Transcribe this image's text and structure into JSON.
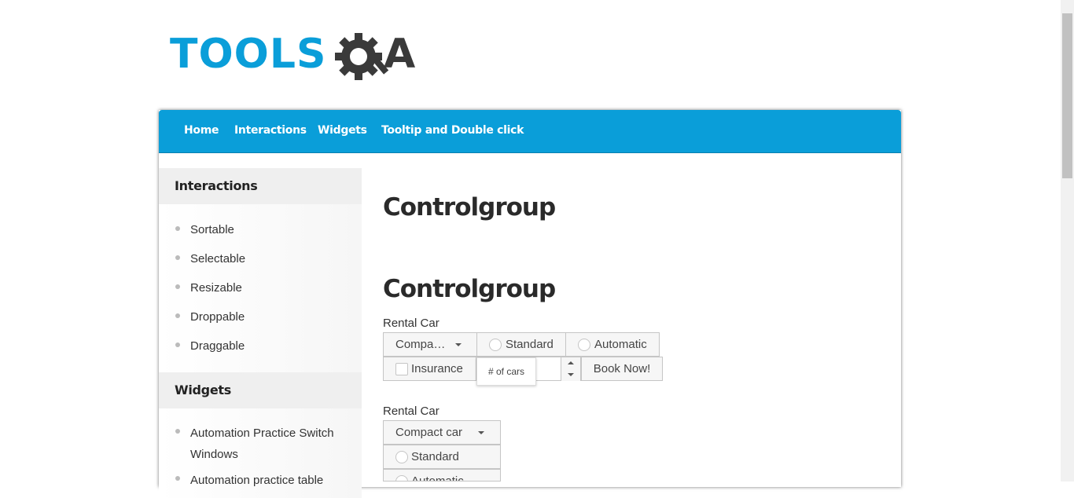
{
  "logo": {
    "text_left": "TOOLS",
    "text_right": "A",
    "brand_color": "#0a9ed9",
    "dark_color": "#3a3a3a"
  },
  "nav": {
    "items": [
      "Home",
      "Interactions",
      "Widgets",
      "Tooltip and Double click"
    ],
    "color": "#0a9ed9"
  },
  "sidebar": {
    "interactions_heading": "Interactions",
    "interactions": [
      "Sortable",
      "Selectable",
      "Resizable",
      "Droppable",
      "Draggable"
    ],
    "widgets_heading": "Widgets",
    "widgets": [
      "Automation Practice Switch Windows",
      "Automation practice table"
    ]
  },
  "main": {
    "title": "Controlgroup",
    "section_title": "Controlgroup",
    "group1": {
      "label": "Rental Car",
      "car_select": "Compa…",
      "standard": "Standard",
      "automatic": "Automatic",
      "insurance": "Insurance",
      "cars_placeholder": "# of cars",
      "book": "Book Now!"
    },
    "group2": {
      "label": "Rental Car",
      "car_select": "Compact car",
      "standard": "Standard",
      "automatic": "Automatic"
    }
  },
  "icons": {
    "select_caret": "caret-down-icon",
    "spinner_up": "arrow-up-icon",
    "spinner_down": "arrow-down-icon",
    "logo_gear": "gear-icon"
  }
}
